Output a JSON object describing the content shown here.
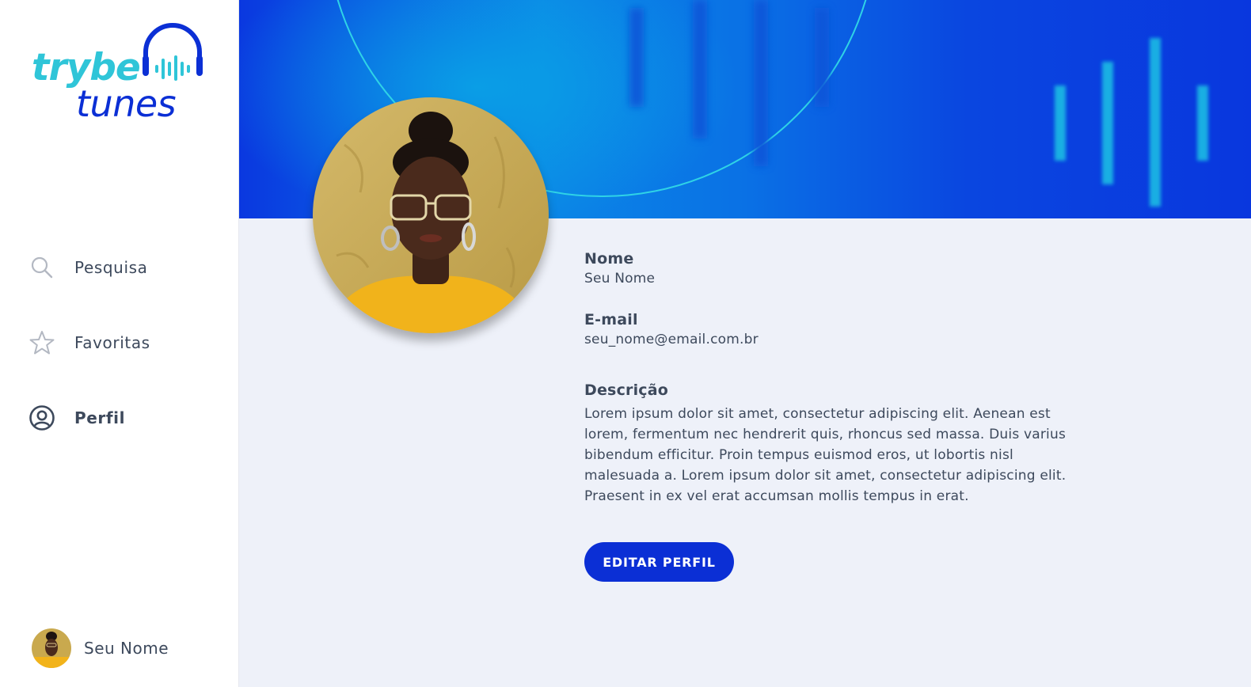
{
  "app": {
    "logo_top": "trybe",
    "logo_bottom": "tunes"
  },
  "sidebar": {
    "items": [
      {
        "label": "Pesquisa",
        "icon": "search-icon",
        "active": false
      },
      {
        "label": "Favoritas",
        "icon": "star-icon",
        "active": false
      },
      {
        "label": "Perfil",
        "icon": "user-circle-icon",
        "active": true
      }
    ],
    "user": {
      "name": "Seu Nome"
    }
  },
  "profile": {
    "name_label": "Nome",
    "name_value": "Seu Nome",
    "email_label": "E-mail",
    "email_value": "seu_nome@email.com.br",
    "description_label": "Descrição",
    "description_value": "Lorem ipsum dolor sit amet, consectetur adipiscing elit. Aenean est lorem, fermentum nec hendrerit quis, rhoncus sed massa. Duis varius bibendum efficitur. Proin tempus euismod eros, ut lobortis nisl malesuada a. Lorem ipsum dolor sit amet, consectetur adipiscing elit. Praesent in ex vel erat accumsan mollis tempus in erat.",
    "edit_button": "EDITAR PERFIL"
  },
  "colors": {
    "brand_blue": "#0b2fd5",
    "brand_cyan": "#2fc5d8",
    "text": "#3d495c",
    "background": "#eef1f9"
  }
}
